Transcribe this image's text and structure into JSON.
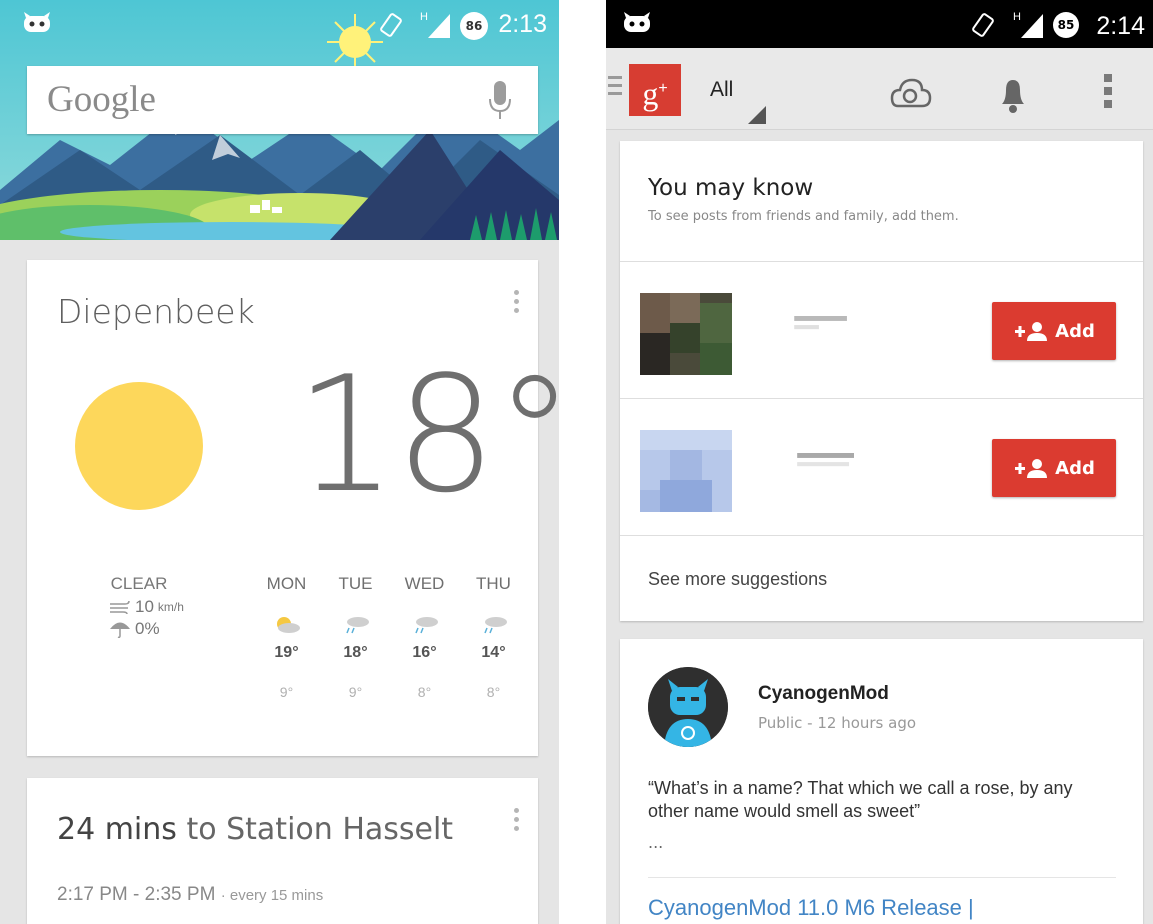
{
  "left_screen": {
    "status_bar": {
      "time": "2:13",
      "battery": "86",
      "icons": [
        "cyanogenmod-icon",
        "rotate-icon",
        "signal-icon",
        "battery-icon"
      ]
    },
    "search": {
      "logo_text": "Google",
      "mic_icon": "mic-icon"
    },
    "weather": {
      "city": "Diepenbeek",
      "temperature": "18°",
      "condition": "CLEAR",
      "wind": "10",
      "wind_unit": "km/h",
      "precip": "0%",
      "forecast": [
        {
          "day": "MON",
          "icon": "partly-sunny-icon",
          "high": "19°",
          "low": "9°"
        },
        {
          "day": "TUE",
          "icon": "rain-cloud-icon",
          "high": "18°",
          "low": "9°"
        },
        {
          "day": "WED",
          "icon": "rain-cloud-icon",
          "high": "16°",
          "low": "8°"
        },
        {
          "day": "THU",
          "icon": "rain-cloud-icon",
          "high": "14°",
          "low": "8°"
        }
      ]
    },
    "route": {
      "duration": "24 mins",
      "destination": "to Station Hasselt",
      "time_range": "2:17 PM - 2:35 PM",
      "frequency": "· every 15 mins"
    }
  },
  "right_screen": {
    "status_bar": {
      "time": "2:14",
      "battery": "85"
    },
    "appbar": {
      "logo": "g+",
      "stream": "All"
    },
    "you_may_know": {
      "title": "You may know",
      "subtitle": "To see posts from friends and family, add them.",
      "add_label": "Add",
      "see_more": "See more suggestions"
    },
    "post": {
      "author": "CyanogenMod",
      "meta": "Public - 12 hours ago",
      "text": "“What’s in a name? That which we call a rose, by any other name would smell as sweet”",
      "ellipsis": "...",
      "link": "CyanogenMod 11.0 M6 Release |"
    }
  },
  "colors": {
    "gplus_red": "#d73d32",
    "add_red": "#db3b30",
    "sun": "#fdd75b",
    "link_blue": "#4285c5"
  }
}
